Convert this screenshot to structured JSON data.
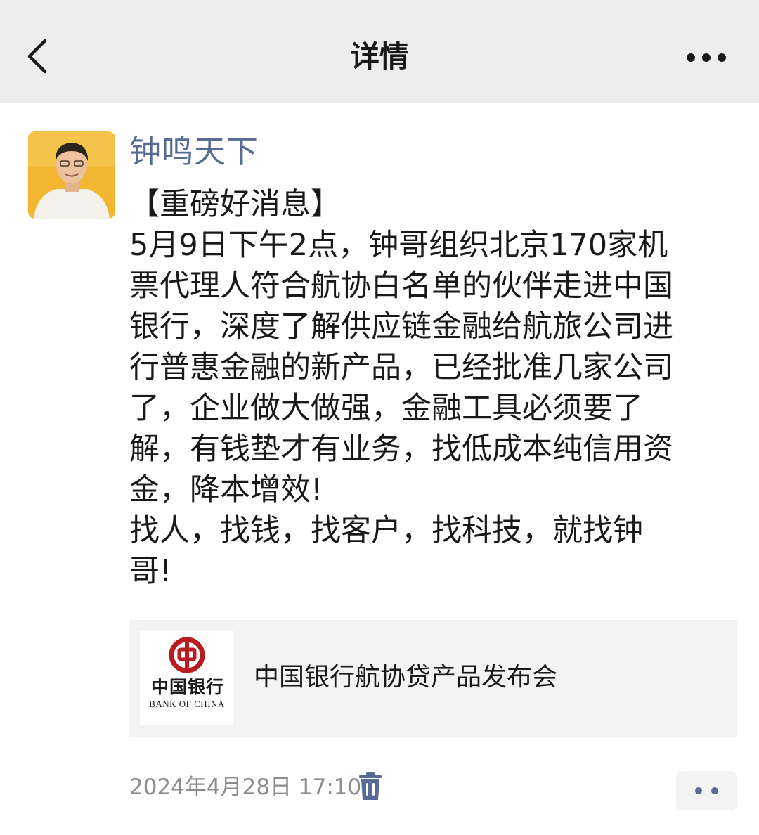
{
  "header": {
    "title": "详情",
    "back_icon": "chevron-left-icon",
    "more_icon": "more-dots-icon"
  },
  "post": {
    "author": "钟鸣天下",
    "lines": [
      "【重磅好消息】",
      "5月9日下午2点，钟哥组织北京170家机",
      "票代理人符合航协白名单的伙伴走进中国",
      "银行，深度了解供应链金融给航旅公司进",
      "行普惠金融的新产品，已经批准几家公司",
      "了，企业做大做强，金融工具必须要了",
      "解，有钱垫才有业务，找低成本纯信用资",
      "金，降本增效!",
      "找人，找钱，找客户，找科技，就找钟",
      "哥!"
    ],
    "link": {
      "title": "中国银行航协贷产品发布会",
      "logo_cn": "中国银行",
      "logo_en": "BANK OF CHINA"
    },
    "timestamp": "2024年4月28日 17:10",
    "delete_icon": "trash-icon",
    "action_icon": "two-dots-icon"
  },
  "colors": {
    "header_bg": "#ededed",
    "name_link": "#576b95",
    "body_text": "#191919",
    "meta_text": "#8c8c8c",
    "boc_red": "#b81c22"
  }
}
